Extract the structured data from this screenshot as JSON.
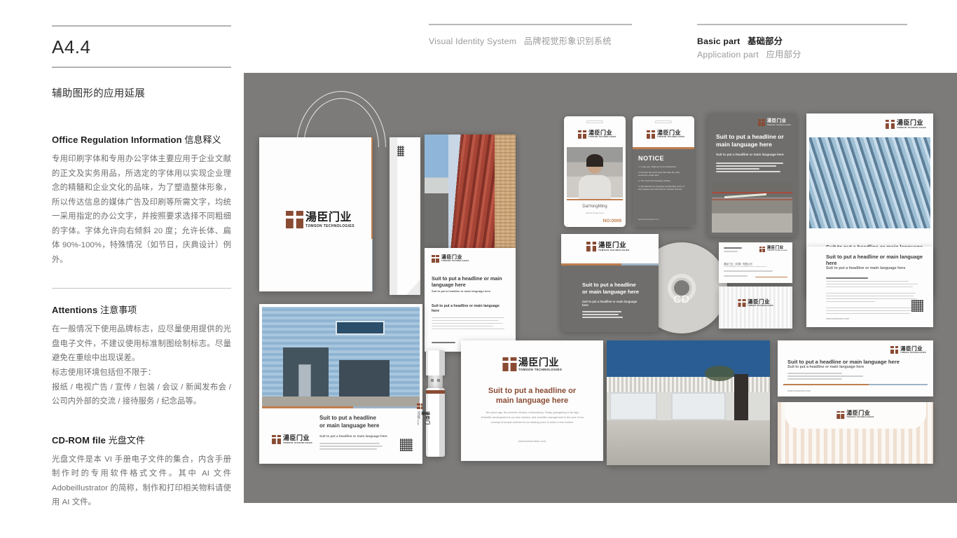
{
  "header": {
    "left_group": {
      "en": "Visual Identity System",
      "cn": "品牌视觉形象识别系统"
    },
    "right_group": {
      "active": {
        "en": "Basic part",
        "cn": "基础部分"
      },
      "inactive": {
        "en": "Application part",
        "cn": "应用部分"
      }
    }
  },
  "sidebar": {
    "page_code": "A4.4",
    "section_title": "辅助图形的应用延展",
    "blocks": [
      {
        "head_en": "Office Regulation Information",
        "head_cn": "信息释义",
        "body": "专用印刷字体和专用办公字体主要应用于企业文献的正文及实务用品，所选定的字体用以实现企业理念的精髓和企业文化的品味，为了塑造整体形象，所以传达信息的媒体广告及印刷等所需文字，均统一采用指定的办公文字，并按照要求选择不同粗细的字体。字体允许向右倾斜 20 度；允许长体、扁体 90%-100%，特殊情况（如节日，庆典设计）例外。"
      },
      {
        "head_en": "Attentions",
        "head_cn": "注意事项",
        "body_1": "在一般情况下使用品牌标志，应尽量使用提供的光盘电子文件，不建议使用标准制图绘制标志。尽量避免在重绘中出现误差。",
        "body_2": "标志使用环境包括但不限于：",
        "body_3": "报纸 / 电视广告 / 宣传 / 包装 / 会议 / 新闻发布会 / 公司内外部的交流 / 接待服务 / 纪念品等。"
      },
      {
        "head_en": "CD-ROM file",
        "head_cn": "光盘文件",
        "body": "光盘文件是本 VI 手册电子文件的集合，内含手册制作时的专用软件格式文件。其中 AI 文件 Adobeillustrator 的简称，制作和打印相关物料请使用 AI 文件。"
      }
    ]
  },
  "brand": {
    "name_cn": "湯臣门业",
    "name_en": "TOMSON TECHNOLOGIES",
    "website": "www.tomsondoor.com",
    "colors": {
      "mark_brown": "#8a4b33",
      "accent_orange": "#c07e4e",
      "canvas_gray": "#7c7b79",
      "rule_gray": "#b3b3b3"
    }
  },
  "mockups": {
    "headline": "Suit to put a headline or main language here",
    "headline_l1": "Suit to put a headline or",
    "headline_l2": "main language here",
    "subhead": "Suit to put a headline or main language here",
    "body_copy": "Ten years ago, the phoenix nirvana, restructuring. Today, guangdong to fly high. Scientific development is our new mission, and scientific management is the core of our concept of people-oriented is our starting point, to build a new modern.",
    "badge": {
      "notice_title": "NOTICE",
      "notice_items": [
        "1. I only use, shall not to be transferred.",
        "2. Present the work wear that take the door, consumer credit card.",
        "3. The card can't bending, folding.",
        "4. Pay attention to keeping, transferring to the, if lost, please report the loss in a timely manner."
      ],
      "person_name": "DaiYongMing",
      "person_dept": "Market Department",
      "card_no": "NO:0009"
    },
    "cd": {
      "disc_label": "CD"
    },
    "business_card": {
      "company_cn": "湯臣门业（中国）有限公司",
      "contact_line": "Tel: 010-00000000  Fax: 010-00000001  E-mail: info@tomson.cn"
    }
  }
}
